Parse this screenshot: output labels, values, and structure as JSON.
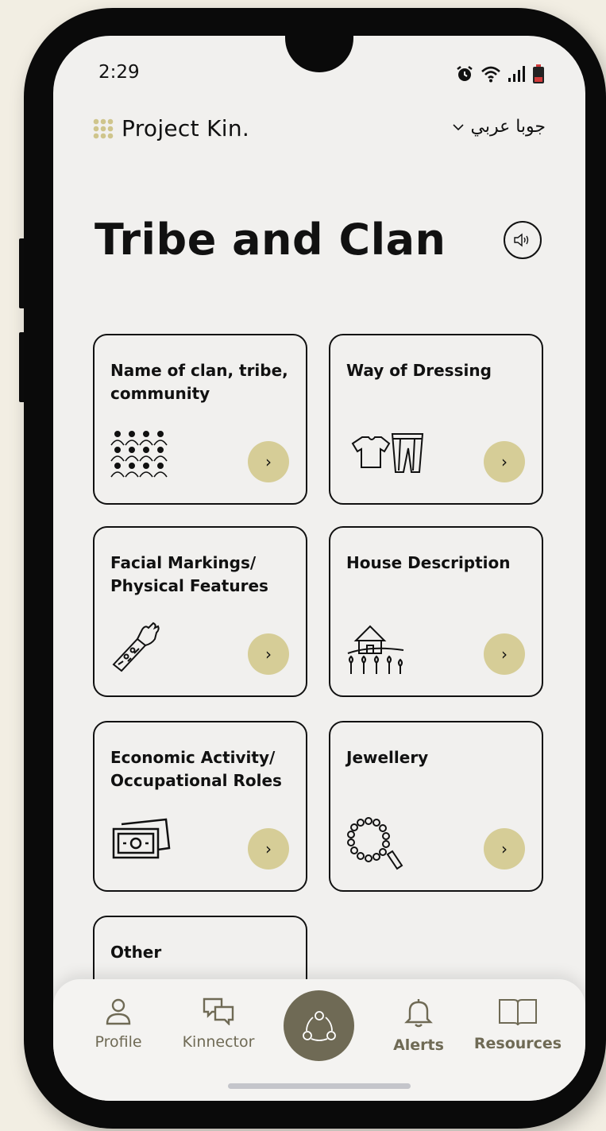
{
  "status_bar": {
    "time": "2:29",
    "icons": [
      "alarm-icon",
      "wifi-icon",
      "signal-icon",
      "battery-icon"
    ]
  },
  "header": {
    "brand": "Project Kin.",
    "language": "جوبا عربي"
  },
  "page": {
    "title": "Tribe and Clan",
    "speaker_icon": "speaker-icon"
  },
  "cards": [
    {
      "title": "Name of clan, tribe, community",
      "icon": "people-group-icon"
    },
    {
      "title": "Way of Dressing",
      "icon": "clothing-icon"
    },
    {
      "title": "Facial Markings/ Physical Features",
      "icon": "tattooed-arm-icon"
    },
    {
      "title": "House Description",
      "icon": "house-icon"
    },
    {
      "title": "Economic Activity/ Occupational Roles",
      "icon": "money-icon"
    },
    {
      "title": "Jewellery",
      "icon": "beads-icon"
    },
    {
      "title": "Other",
      "icon": ""
    }
  ],
  "tabbar": {
    "profile": "Profile",
    "kinnector": "Kinnector",
    "alerts": "Alerts",
    "resources": "Resources",
    "center_icon": "network-icon"
  },
  "colors": {
    "accent": "#d6cd97",
    "nav": "#6f6a55",
    "screen": "#f1f0ee"
  }
}
